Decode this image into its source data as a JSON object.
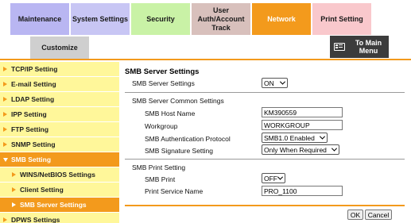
{
  "tabs": [
    {
      "label": "Maintenance",
      "color": "#b9b6f2"
    },
    {
      "label": "System Settings",
      "color": "#c8c6f4"
    },
    {
      "label": "Security",
      "color": "#c9f2a6"
    },
    {
      "label": "User Auth/Account Track",
      "color": "#d8c0bc"
    },
    {
      "label": "Network",
      "color": "#f39a1c"
    },
    {
      "label": "Print Setting",
      "color": "#f9c8cc"
    }
  ],
  "tab_customize": {
    "label": "Customize",
    "color": "#cfcfcf"
  },
  "to_main_menu": {
    "label": "To Main Menu",
    "icon": "menu-list-icon"
  },
  "sidebar": {
    "items": [
      {
        "label": "TCP/IP Setting"
      },
      {
        "label": "E-mail Setting"
      },
      {
        "label": "LDAP Setting"
      },
      {
        "label": "IPP Setting"
      },
      {
        "label": "FTP Setting"
      },
      {
        "label": "SNMP Setting"
      },
      {
        "label": "SMB Setting",
        "expanded": true
      },
      {
        "label": "WINS/NetBIOS Settings",
        "sub": true
      },
      {
        "label": "Client Setting",
        "sub": true
      },
      {
        "label": "SMB Server Settings",
        "sub": true,
        "active": true
      },
      {
        "label": "DPWS Settings"
      }
    ]
  },
  "content": {
    "title": "SMB Server Settings",
    "server_settings_label": "SMB Server Settings",
    "server_settings_value": "ON",
    "common_header": "SMB Server Common Settings",
    "host_name_label": "SMB Host Name",
    "host_name_value": "KM390559",
    "workgroup_label": "Workgroup",
    "workgroup_value": "WORKGROUP",
    "auth_protocol_label": "SMB Authentication Protocol",
    "auth_protocol_value": "SMB1.0 Enabled",
    "signature_label": "SMB Signature Setting",
    "signature_value": "Only When Required",
    "print_header": "SMB Print Setting",
    "print_label": "SMB Print",
    "print_value": "OFF",
    "print_service_label": "Print Service Name",
    "print_service_value": "PRO_1100"
  },
  "buttons": {
    "ok": "OK",
    "cancel": "Cancel"
  },
  "colors": {
    "accent": "#f39a1c",
    "sidebar_bg": "#fff79a"
  }
}
